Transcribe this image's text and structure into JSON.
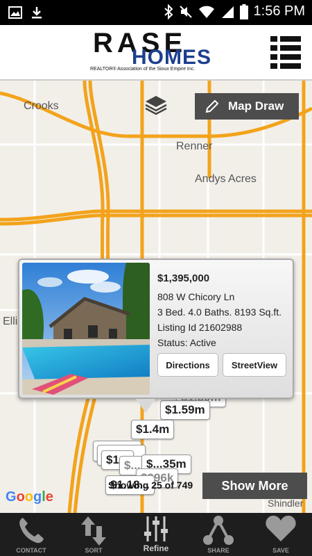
{
  "status_bar": {
    "time": "1:56 PM"
  },
  "header": {
    "logo": {
      "line1": "RASE",
      "line2": "HOMES",
      "tagline": "REALTOR® Association of the Sioux Empire Inc."
    }
  },
  "map": {
    "places": [
      "Crooks",
      "Renner",
      "Andys Acres",
      "Ellis",
      "Shindler"
    ],
    "map_draw_label": "Map Draw",
    "attribution": "Google"
  },
  "listing_popup": {
    "price": "$1,395,000",
    "address": "808 W Chicory Ln",
    "details": "3 Bed. 4.0 Baths. 8193 Sq.ft.",
    "listing_id": "Listing Id 21602988",
    "status": "Status: Active",
    "directions_label": "Directions",
    "streetview_label": "StreetView"
  },
  "price_markers": [
    "$1.59m",
    "$1.4m",
    "$1...",
    "$...",
    "$...35m",
    "$996k",
    "$1.18..."
  ],
  "results": {
    "showing_text": "Showing 25 of 749",
    "show_more_label": "Show More"
  },
  "bottom_nav": [
    {
      "label": "CONTACT",
      "icon": "phone-icon"
    },
    {
      "label": "SORT",
      "icon": "sort-arrows-icon"
    },
    {
      "label": "Refine",
      "icon": "sliders-icon"
    },
    {
      "label": "SHARE",
      "icon": "share-icon"
    },
    {
      "label": "SAVE",
      "icon": "heart-icon"
    }
  ],
  "colors": {
    "road": "#f3a31b",
    "button_dark": "#4d4d4d",
    "brand_blue": "#1d3f8f",
    "nav_bg": "#1e1e1e"
  }
}
